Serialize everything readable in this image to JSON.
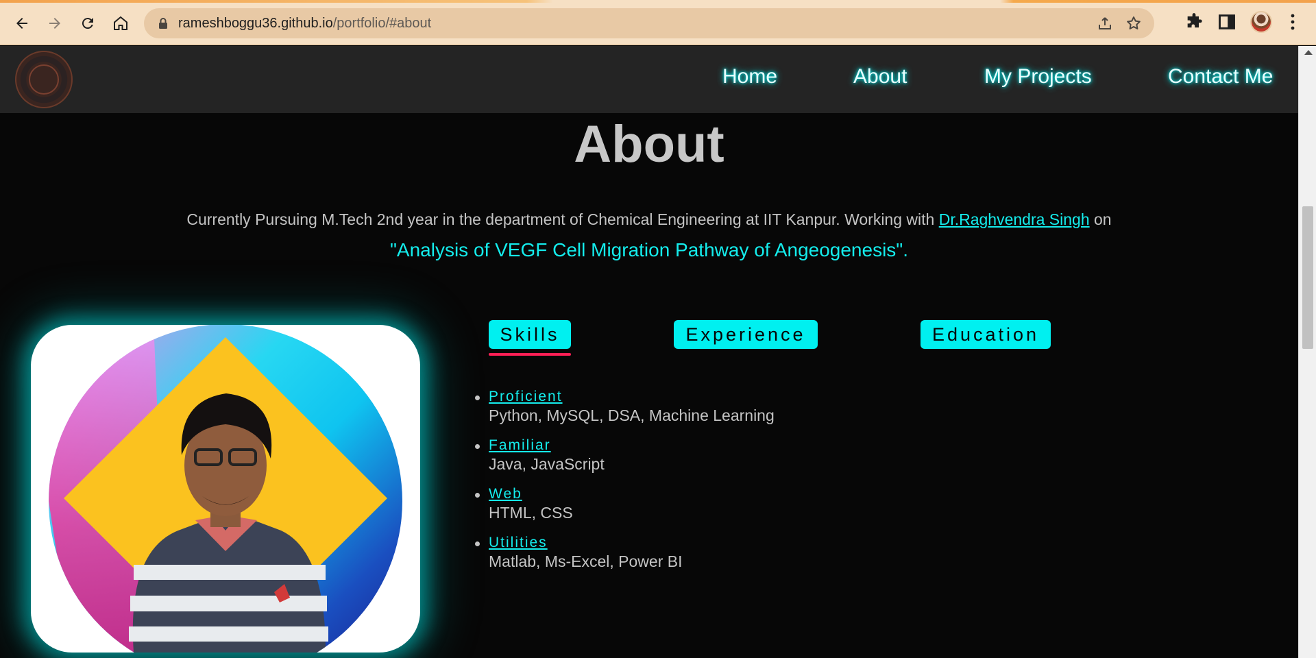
{
  "browser": {
    "url_domain": "rameshboggu36.github.io",
    "url_path": "/portfolio/#about",
    "icons": [
      "back-icon",
      "forward-icon",
      "reload-icon",
      "home-icon",
      "lock-icon",
      "share-icon",
      "star-icon",
      "extensions-icon",
      "side-panel-icon",
      "profile-avatar",
      "more-menu-icon"
    ]
  },
  "nav": {
    "links": [
      "Home",
      "About",
      "My Projects",
      "Contact Me"
    ]
  },
  "about": {
    "title": "About",
    "intro_text": "Currently Pursuing M.Tech 2nd year in the department of Chemical Engineering at IIT Kanpur. Working with ",
    "advisor_link": "Dr.Raghvendra Singh",
    "intro_suffix": " on",
    "project_quote": "\"Analysis of VEGF Cell Migration Pathway of Angeogenesis\"."
  },
  "tabs": [
    "Skills",
    "Experience",
    "Education"
  ],
  "active_tab": "Skills",
  "skills": [
    {
      "heading": "Proficient",
      "items": "Python, MySQL, DSA, Machine Learning"
    },
    {
      "heading": "Familiar",
      "items": "Java, JavaScript"
    },
    {
      "heading": "Web",
      "items": "HTML, CSS"
    },
    {
      "heading": "Utilities",
      "items": "Matlab, Ms-Excel, Power BI"
    }
  ],
  "colors": {
    "accent_cyan": "#14eded",
    "tab_bg": "#00f0f0",
    "underline_red": "#ff1f55",
    "navbar_bg": "#242424",
    "page_bg": "#070707"
  }
}
